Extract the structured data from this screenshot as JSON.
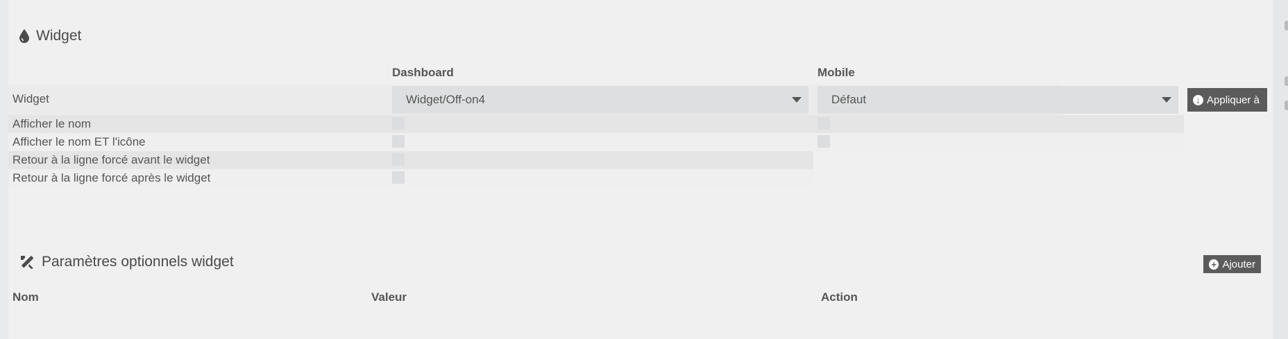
{
  "widget_section": {
    "title": "Widget",
    "columns": {
      "dashboard": "Dashboard",
      "mobile": "Mobile"
    },
    "rows": [
      {
        "label": "Widget",
        "dashboard_value": "Widget/Off-on4",
        "mobile_value": "Défaut"
      },
      {
        "label": "Afficher le nom"
      },
      {
        "label": "Afficher le nom ET l'icône"
      },
      {
        "label": "Retour à la ligne forcé avant le widget"
      },
      {
        "label": "Retour à la ligne forcé après le widget"
      }
    ],
    "apply_button": "Appliquer à"
  },
  "optional_section": {
    "title": "Paramètres optionnels widget",
    "add_button": "Ajouter",
    "columns": {
      "name": "Nom",
      "value": "Valeur",
      "action": "Action"
    }
  },
  "icons": {
    "widget_title": "droplet-icon",
    "optional_title": "tools-icon",
    "apply": "download-circle-icon",
    "add": "plus-circle-icon"
  }
}
